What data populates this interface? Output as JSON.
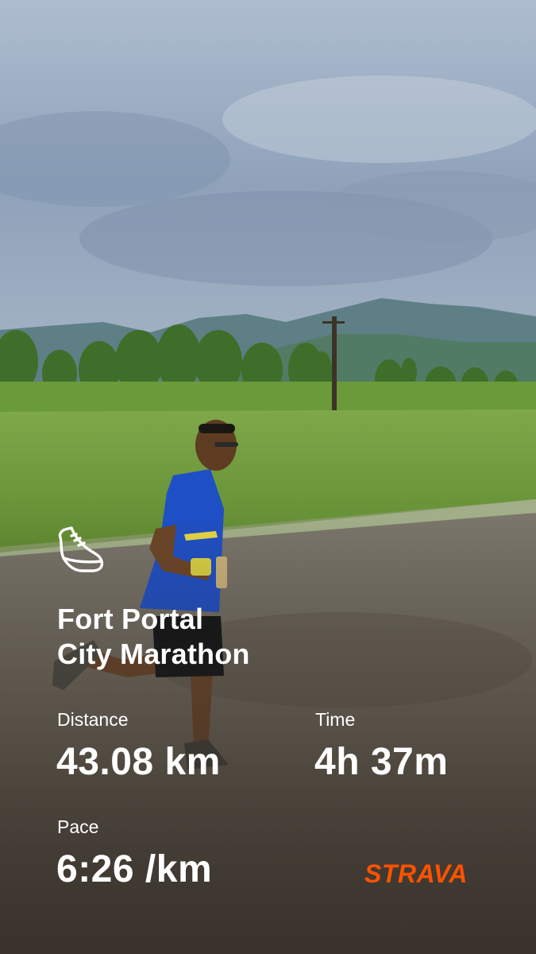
{
  "activity": {
    "title_line1": "Fort Portal",
    "title_line2": "City Marathon",
    "icon": "running-shoe-icon"
  },
  "stats": {
    "distance": {
      "label": "Distance",
      "value": "43.08 km"
    },
    "time": {
      "label": "Time",
      "value": "4h 37m"
    },
    "pace": {
      "label": "Pace",
      "value": "6:26 /km"
    }
  },
  "brand": {
    "logo_text": "STRAVA",
    "color": "#fc5200"
  },
  "colors": {
    "text": "#ffffff",
    "sky": "#9fb1c6",
    "grass": "#6f9a3a",
    "road": "#6a6458",
    "jersey": "#1f4fc4"
  }
}
